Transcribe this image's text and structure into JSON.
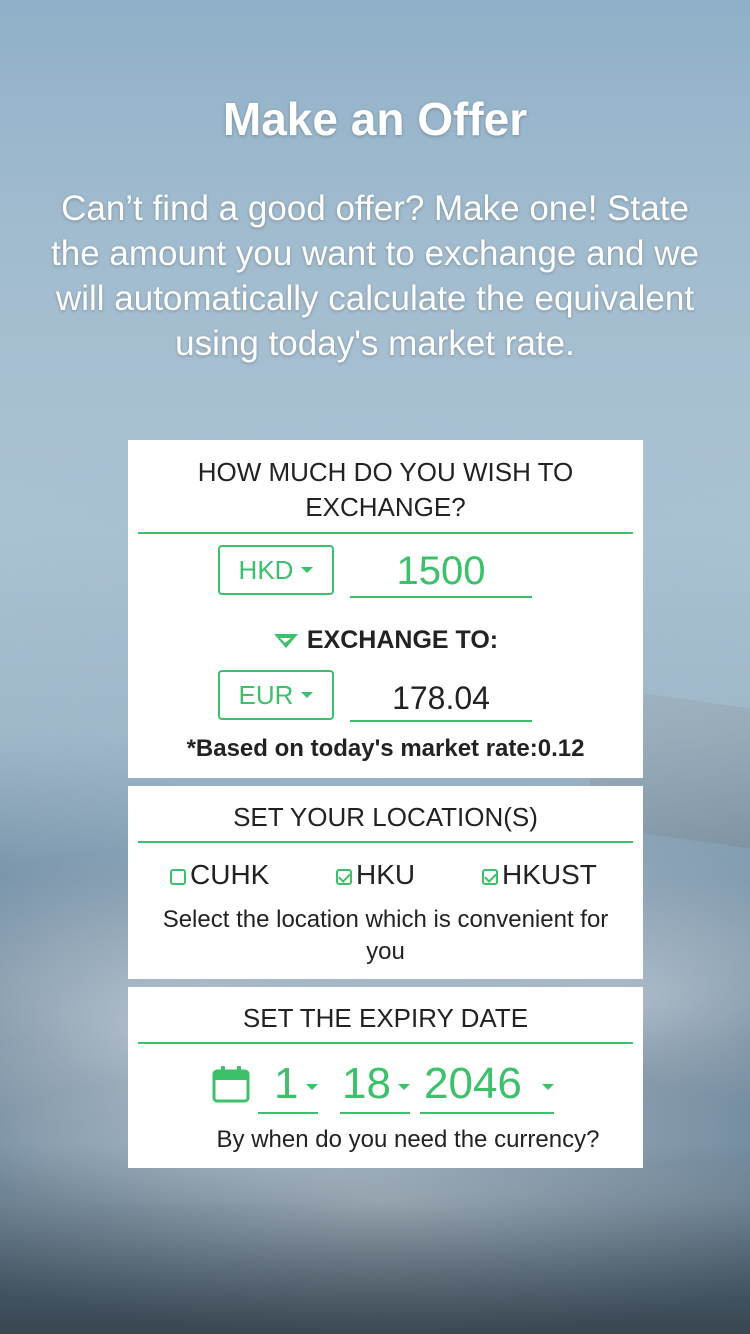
{
  "hero": {
    "title": "Make an Offer",
    "description": "Can’t find a good offer? Make one! State the amount you want to exchange and we will automatically calculate the equivalent using today's market rate."
  },
  "exchange": {
    "title": "HOW MUCH DO YOU WISH TO EXCHANGE?",
    "from_currency": "HKD",
    "from_amount": "1500",
    "exchange_to_label": "EXCHANGE TO:",
    "to_currency": "EUR",
    "to_amount": "178.04",
    "rate_note": "*Based on today's market rate:0.12"
  },
  "location": {
    "title": "SET YOUR LOCATION(S)",
    "options": [
      {
        "label": "CUHK",
        "checked": false
      },
      {
        "label": "HKU",
        "checked": true
      },
      {
        "label": "HKUST",
        "checked": true
      }
    ],
    "hint": "Select the location which is convenient for you"
  },
  "expiry": {
    "title": "SET THE EXPIRY DATE",
    "month": "1",
    "day": "18",
    "year": "2046",
    "hint": "By when do you need the currency?"
  },
  "colors": {
    "accent": "#3cc06a",
    "text": "#222222"
  }
}
